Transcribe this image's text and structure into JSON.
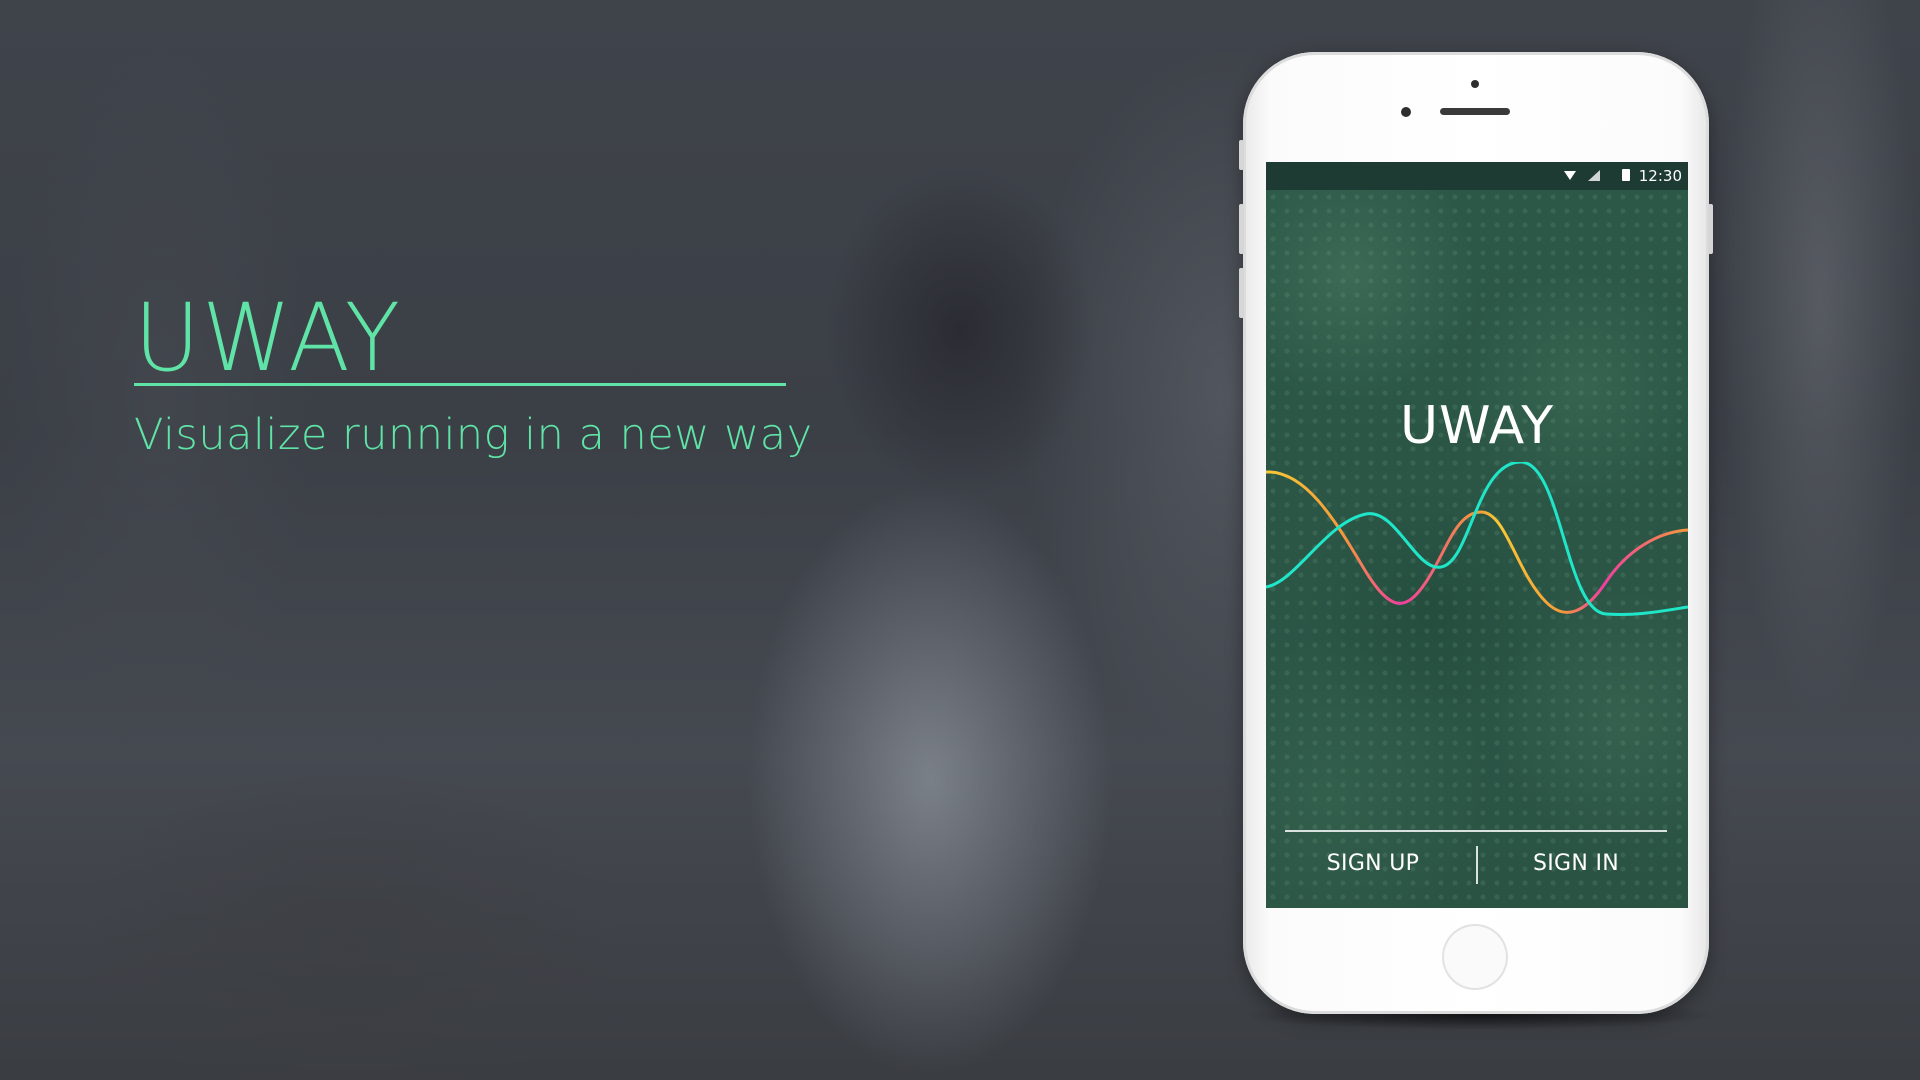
{
  "hero": {
    "title": "UWAY",
    "subtitle": "Visualize running in a new way"
  },
  "colors": {
    "accent": "#5fe3a6",
    "wave_cyan": "#1fe6c8",
    "wave_yellow": "#f6c936",
    "wave_pink": "#f03ea0",
    "wave_orange": "#f59a3a"
  },
  "phone": {
    "status_bar": {
      "time": "12:30",
      "icons": [
        "wifi-icon",
        "signal-icon",
        "battery-icon"
      ]
    },
    "app_title": "UWAY",
    "actions": {
      "sign_up": "SIGN UP",
      "sign_in": "SIGN IN"
    }
  }
}
